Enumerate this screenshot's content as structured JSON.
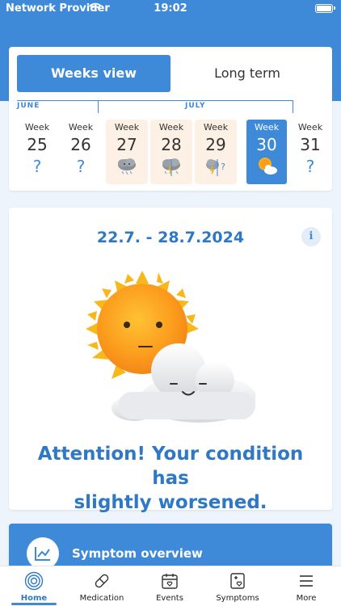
{
  "status_bar": {
    "carrier": "Network Provider",
    "time": "19:02"
  },
  "toggle": {
    "weeks_view": "Weeks view",
    "long_term": "Long term"
  },
  "months": [
    {
      "label": "JUNE"
    },
    {
      "label": "JULY"
    }
  ],
  "weeks": [
    {
      "label": "Week",
      "number": "25",
      "status": "unknown",
      "symbol": "?"
    },
    {
      "label": "Week",
      "number": "26",
      "status": "unknown",
      "symbol": "?"
    },
    {
      "label": "Week",
      "number": "27",
      "status": "storm"
    },
    {
      "label": "Week",
      "number": "28",
      "status": "storm-partial"
    },
    {
      "label": "Week",
      "number": "29",
      "status": "storm-partial"
    },
    {
      "label": "Week",
      "number": "30",
      "status": "sun-cloud",
      "selected": true
    },
    {
      "label": "Week",
      "number": "31",
      "status": "unknown",
      "symbol": "?"
    }
  ],
  "main": {
    "date_range": "22.7. - 28.7.2024",
    "info_symbol": "i",
    "attention_line1": "Attention! Your condition has",
    "attention_line2": "slightly worsened."
  },
  "symptom_card": {
    "title": "Symptom overview",
    "icon": "chart-icon"
  },
  "tabs": [
    {
      "label": "Home",
      "icon": "home-icon",
      "active": true
    },
    {
      "label": "Medication",
      "icon": "pill-icon"
    },
    {
      "label": "Events",
      "icon": "calendar-icon"
    },
    {
      "label": "Symptoms",
      "icon": "symptoms-icon"
    },
    {
      "label": "More",
      "icon": "menu-icon"
    }
  ],
  "colors": {
    "primary": "#3f8ad8",
    "text_blue": "#2e78c5",
    "worse_bg": "#fdf0e5"
  }
}
